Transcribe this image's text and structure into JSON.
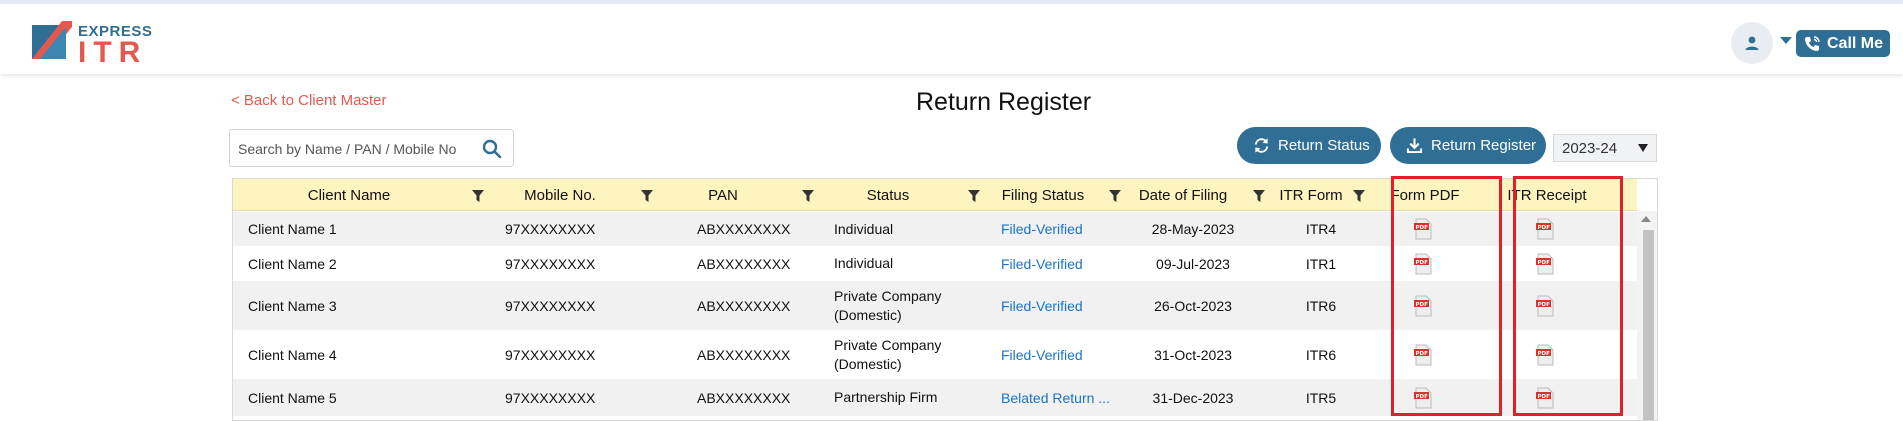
{
  "header": {
    "logo": {
      "top_text": "EXPRESS",
      "bottom_text": "ITR"
    },
    "avatar_icon": "user-icon",
    "call_button": {
      "label": "Call Me",
      "icon": "phone-icon"
    }
  },
  "toolbar": {
    "back_link": "< Back to Client Master",
    "page_title": "Return Register",
    "search": {
      "placeholder": "Search by Name / PAN / Mobile No",
      "value": "",
      "icon": "search-icon"
    },
    "return_status_label": "Return Status",
    "return_register_label": "Return Register",
    "year_selected": "2023-24"
  },
  "table": {
    "columns": [
      "Client Name",
      "Mobile No.",
      "PAN",
      "Status",
      "Filing Status",
      "Date of Filing",
      "ITR Form",
      "Form PDF",
      "ITR Receipt"
    ],
    "rows": [
      {
        "client_name": "Client Name 1",
        "mobile": "97XXXXXXXX",
        "pan": "ABXXXXXXXX",
        "status": [
          "Individual"
        ],
        "filing_status": "Filed-Verified",
        "date": "28-May-2023",
        "itr_form": "ITR4"
      },
      {
        "client_name": "Client Name 2",
        "mobile": "97XXXXXXXX",
        "pan": "ABXXXXXXXX",
        "status": [
          "Individual"
        ],
        "filing_status": "Filed-Verified",
        "date": "09-Jul-2023",
        "itr_form": "ITR1"
      },
      {
        "client_name": "Client Name 3",
        "mobile": "97XXXXXXXX",
        "pan": "ABXXXXXXXX",
        "status": [
          "Private Company",
          "(Domestic)"
        ],
        "filing_status": "Filed-Verified",
        "date": "26-Oct-2023",
        "itr_form": "ITR6"
      },
      {
        "client_name": "Client Name 4",
        "mobile": "97XXXXXXXX",
        "pan": "ABXXXXXXXX",
        "status": [
          "Private Company",
          "(Domestic)"
        ],
        "filing_status": "Filed-Verified",
        "date": "31-Oct-2023",
        "itr_form": "ITR6"
      },
      {
        "client_name": "Client Name 5",
        "mobile": "97XXXXXXXX",
        "pan": "ABXXXXXXXX",
        "status": [
          "Partnership Firm"
        ],
        "filing_status": "Belated Return ...",
        "date": "31-Dec-2023",
        "itr_form": "ITR5"
      }
    ]
  },
  "colors": {
    "brand_blue": "#2f6f96",
    "brand_red": "#e15a4f",
    "link_blue": "#1a73c8",
    "header_yellow": "#fdf4c0",
    "highlight_red": "#e0202a"
  }
}
